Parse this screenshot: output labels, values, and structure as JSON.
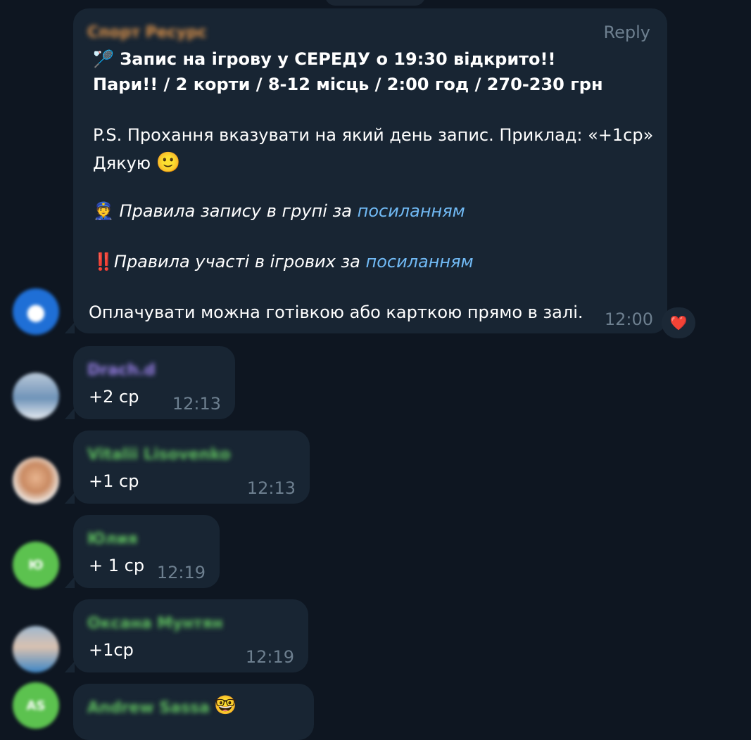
{
  "messages": [
    {
      "sender": "Спорт Ресурс",
      "reply_label": "Reply",
      "title_emoji": "🏸",
      "title": "Запис на ігрову у СЕРЕДУ о 19:30 відкрито!!",
      "subtitle": "Пари!!  / 2 корти / 8-12 місць / 2:00 год / 270-230 грн",
      "ps_line": "P.S.  Прохання вказувати на який день запис.  Приклад: «+1ср»",
      "thanks": "Дякую",
      "thanks_emoji": "🙂",
      "rules1_emoji": "👮",
      "rules1_text": "Правила запису в групі за ",
      "rules1_link": "посиланням",
      "rules2_emoji": "‼️",
      "rules2_text": "Правила участі в ігрових за ",
      "rules2_link": "посиланням",
      "payment": "Оплачувати можна готівкою або карткою прямо в залі.",
      "time": "12:00",
      "reaction": "❤️"
    },
    {
      "sender": "Drach.d",
      "text": "+2 ср",
      "time": "12:13"
    },
    {
      "sender": "Vitalii Lisovenko",
      "text": "+1 ср",
      "time": "12:13"
    },
    {
      "sender": "Юлия",
      "avatar_initials": "Ю",
      "text": "+ 1 ср",
      "time": "12:19"
    },
    {
      "sender": "Оксана Мунтян",
      "text": "+1ср",
      "time": "12:19"
    },
    {
      "sender": "Andrew Sassa",
      "avatar_initials": "AS",
      "sender_emoji": "🤓"
    }
  ],
  "colors": {
    "background": "#0e1621",
    "bubble": "#182533",
    "link": "#71baf5",
    "time": "#6d7f8f",
    "sender_orange": "#d9914a",
    "sender_purple": "#9a80e8",
    "sender_green": "#5fbf5f"
  }
}
